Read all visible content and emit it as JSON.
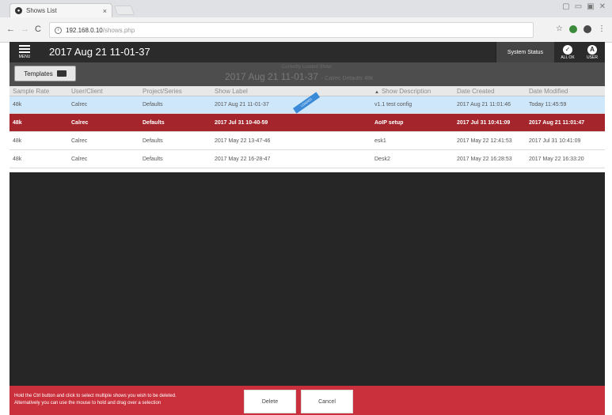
{
  "browser": {
    "tab_title": "Shows List",
    "tab_close": "×",
    "url_host": "192.168.0.10",
    "url_path": "/shows.php",
    "win_controls": [
      "▢",
      "▭",
      "▣",
      "✕"
    ]
  },
  "app_header": {
    "menu_label": "MENU",
    "title": "2017 Aug 21 11-01-37",
    "system_status": "System Status",
    "allok_label": "ALL OK",
    "user_label": "USER"
  },
  "subheader": {
    "templates_label": "Templates",
    "current_label": "Currently Loaded Show:",
    "current_show": "2017 Aug 21 11-01-37",
    "current_meta": "- Calrec   Defaults   48k"
  },
  "table": {
    "headers": {
      "sample_rate": "Sample Rate",
      "user_client": "User/Client",
      "project_series": "Project/Series",
      "show_label": "Show Label",
      "show_description": "Show Description",
      "date_created": "Date Created",
      "date_modified": "Date Modified"
    },
    "sort_indicator": "▲",
    "loaded_ribbon": "LOADED",
    "rows": [
      {
        "sample_rate": "48k",
        "user": "Calrec",
        "project": "Defaults",
        "label": "2017 Aug 21 11-01-37",
        "description": "v1.1 test config",
        "created": "2017 Aug 21 11:01:46",
        "modified": "Today 11:45:59"
      },
      {
        "sample_rate": "48k",
        "user": "Calrec",
        "project": "Defaults",
        "label": "2017 Jul 31 10-40-59",
        "description": "AoIP setup",
        "created": "2017 Jul 31 10:41:09",
        "modified": "2017 Aug 21 11:01:47"
      },
      {
        "sample_rate": "48k",
        "user": "Calrec",
        "project": "Defaults",
        "label": "2017 May 22 13-47-46",
        "description": "esk1",
        "created": "2017 May 22 12:41:53",
        "modified": "2017 Jul 31 10:41:09"
      },
      {
        "sample_rate": "48k",
        "user": "Calrec",
        "project": "Defaults",
        "label": "2017 May 22 16-28-47",
        "description": "Desk2",
        "created": "2017 May 22 16:28:53",
        "modified": "2017 May 22 16:33:20"
      }
    ]
  },
  "footer": {
    "message_line1": "Hold the Ctrl button and click to select multiple shows you wish to be deleted.",
    "message_line2": "Alternatively you can use the mouse to hold and drag over a selection",
    "delete_label": "Delete",
    "cancel_label": "Cancel"
  }
}
